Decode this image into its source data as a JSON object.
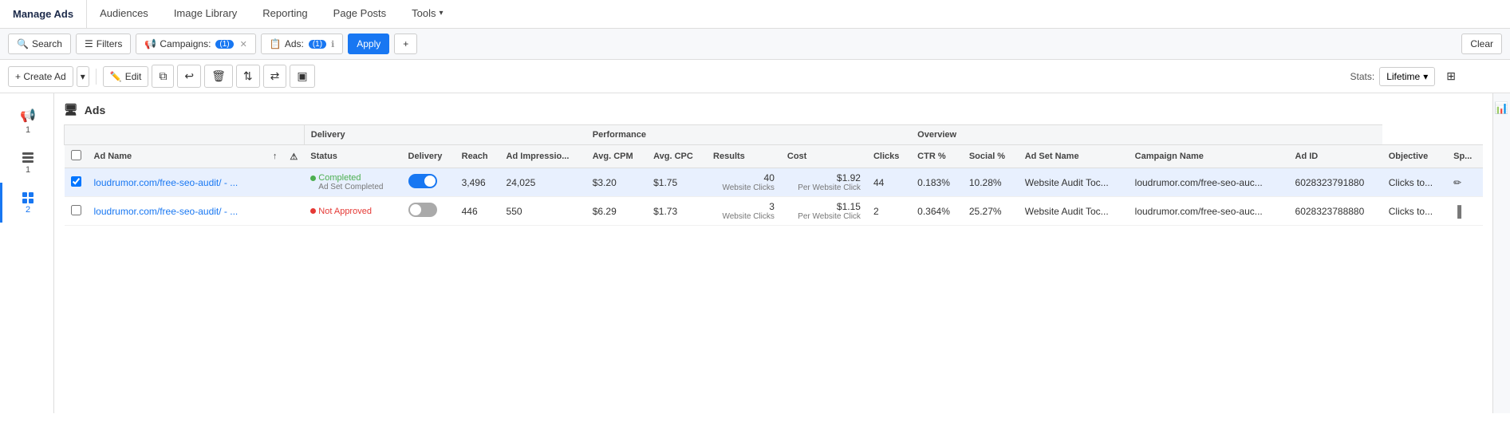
{
  "topNav": {
    "title": "Manage Ads",
    "tabs": [
      {
        "label": "Audiences",
        "active": false
      },
      {
        "label": "Image Library",
        "active": false
      },
      {
        "label": "Reporting",
        "active": false
      },
      {
        "label": "Page Posts",
        "active": false
      },
      {
        "label": "Tools",
        "active": false,
        "hasChevron": true
      }
    ]
  },
  "toolbar": {
    "searchLabel": "Search",
    "filtersLabel": "Filters",
    "campaignsLabel": "Campaigns:",
    "campaignsCount": "(1)",
    "adsLabel": "Ads:",
    "adsCount": "(1)",
    "applyLabel": "Apply",
    "addLabel": "+",
    "clearLabel": "Clear"
  },
  "actionBar": {
    "createAdLabel": "+ Create Ad",
    "editLabel": "Edit",
    "statsLabel": "Stats:",
    "statsValue": "Lifetime"
  },
  "sidebar": {
    "items": [
      {
        "label": "1",
        "type": "campaign",
        "active": false
      },
      {
        "label": "1",
        "type": "adset",
        "active": false
      },
      {
        "label": "2",
        "type": "ads",
        "active": true
      }
    ]
  },
  "adsSection": {
    "title": "Ads",
    "columns": {
      "adName": "Ad Name",
      "status": "Status",
      "delivery": "Delivery",
      "deliveryGroup": "Delivery",
      "reach": "Reach",
      "adImpressions": "Ad Impressio...",
      "avgCpm": "Avg. CPM",
      "avgCpc": "Avg. CPC",
      "performanceGroup": "Performance",
      "results": "Results",
      "cost": "Cost",
      "clicks": "Clicks",
      "ctr": "CTR %",
      "social": "Social %",
      "overviewGroup": "Overview",
      "adSetName": "Ad Set Name",
      "campaignName": "Campaign Name",
      "adId": "Ad ID",
      "objective": "Objective",
      "sp": "Sp..."
    },
    "rows": [
      {
        "id": 1,
        "selected": true,
        "adName": "loudrumor.com/free-seo-audit/ - ...",
        "statusLabel": "Completed",
        "statusSub": "Ad Set Completed",
        "statusType": "completed",
        "deliveryOn": true,
        "reach": "3,496",
        "adImpressions": "24,025",
        "avgCpm": "$3.20",
        "avgCpc": "$1.75",
        "results": "40",
        "resultsLabel": "Website Clicks",
        "cost": "$1.92",
        "costLabel": "Per Website Click",
        "clicks": "44",
        "ctr": "0.183%",
        "social": "10.28%",
        "adSetName": "Website Audit Toc...",
        "campaignName": "loudrumor.com/free-seo-auc...",
        "adId": "6028323791880",
        "objective": "Clicks to...",
        "sp": ""
      },
      {
        "id": 2,
        "selected": false,
        "adName": "loudrumor.com/free-seo-audit/ - ...",
        "statusLabel": "Not Approved",
        "statusSub": "",
        "statusType": "not-approved",
        "deliveryOn": false,
        "reach": "446",
        "adImpressions": "550",
        "avgCpm": "$6.29",
        "avgCpc": "$1.73",
        "results": "3",
        "resultsLabel": "Website Clicks",
        "cost": "$1.15",
        "costLabel": "Per Website Click",
        "clicks": "2",
        "ctr": "0.364%",
        "social": "25.27%",
        "adSetName": "Website Audit Toc...",
        "campaignName": "loudrumor.com/free-seo-auc...",
        "adId": "6028323788880",
        "objective": "Clicks to...",
        "sp": ""
      }
    ]
  },
  "icons": {
    "search": "🔍",
    "filter": "☰",
    "campaigns": "📢",
    "ads": "📋",
    "plus": "+",
    "edit": "✏️",
    "duplicate": "⧉",
    "undo": "↩",
    "delete": "🗑",
    "sort": "⇅",
    "move": "⇄",
    "preview": "▣",
    "columns": "⊞",
    "chart": "📊",
    "monitor": "🖥",
    "chevronDown": "▾",
    "pencil": "✏",
    "barChart": "▐"
  }
}
